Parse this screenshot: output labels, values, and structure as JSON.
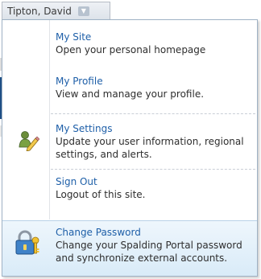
{
  "user_menu": {
    "user_name": "Tipton, David",
    "items": [
      {
        "title": "My Site",
        "description": "Open your personal homepage"
      },
      {
        "title": "My Profile",
        "description": "View and manage your profile."
      },
      {
        "title": "My Settings",
        "description": "Update your user information, regional settings, and alerts."
      },
      {
        "title": "Sign Out",
        "description": "Logout of this site."
      },
      {
        "title": "Change Password",
        "description": "Change your Spalding Portal password and synchronize external accounts."
      }
    ],
    "icons": {
      "settings": "person-pencil-icon",
      "change_password": "padlock-keys-icon"
    },
    "colors": {
      "link": "#1e5fa8",
      "highlight": "#d9ebf8"
    }
  }
}
